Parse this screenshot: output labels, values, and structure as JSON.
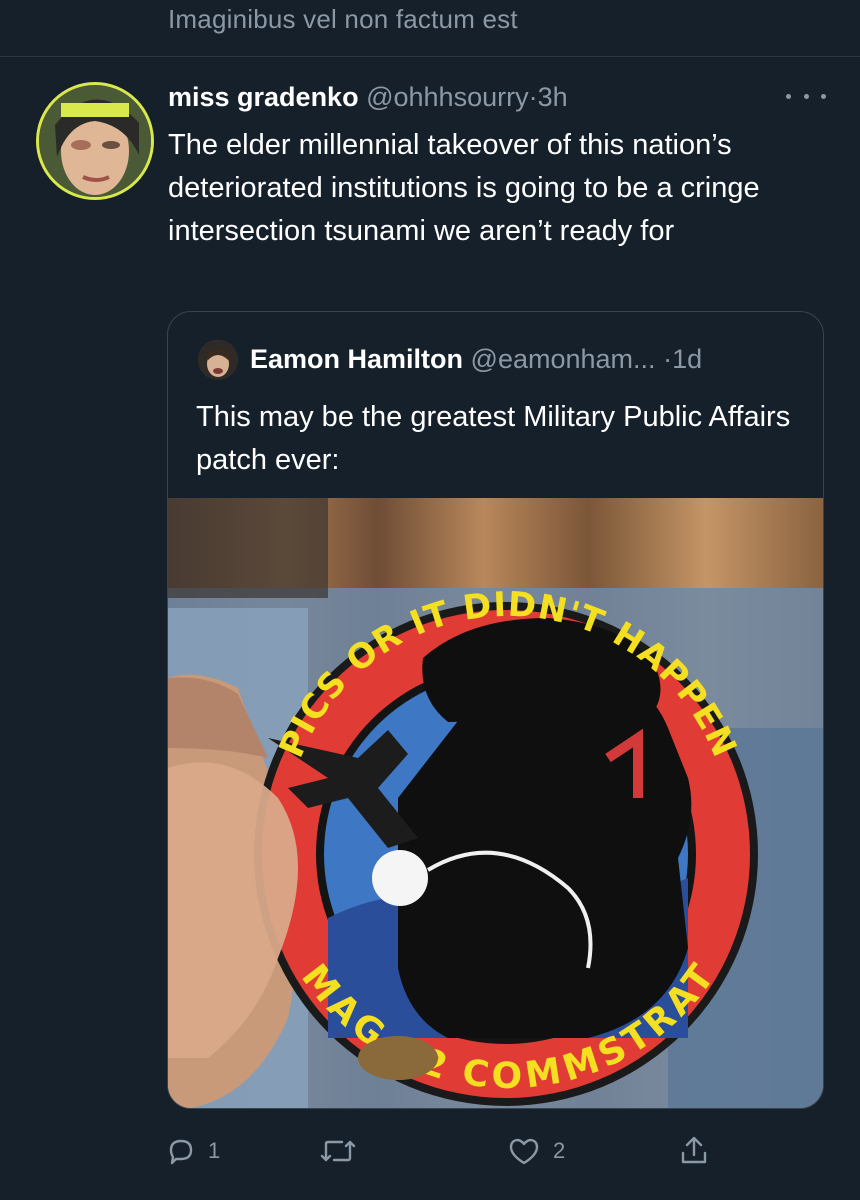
{
  "banner": {
    "text": "Imaginibus vel non factum est"
  },
  "tweet": {
    "author_name": "miss gradenko",
    "author_handle": "@ohhhsourry",
    "separator": "·",
    "time": "3h",
    "text": "The elder millennial takeover of this nation’s deteriorated institutions is going to be a cringe intersection tsunami we aren’t ready for"
  },
  "quote": {
    "author_name": "Eamon Hamilton",
    "author_handle": "@eamonham...",
    "separator": "·",
    "time": "1d",
    "text": "This may be the greatest Military Public Affairs patch ever:",
    "image": {
      "patch_top_text": "PICS OR IT DIDN'T HAPPEN",
      "patch_bottom_text": "MAG-12 COMMSTRAT"
    }
  },
  "actions": {
    "reply_count": "1",
    "retweet_count": "",
    "like_count": "2"
  },
  "colors": {
    "background": "#15202b",
    "secondary_text": "#8b98a5",
    "border": "#38444d"
  },
  "icons": [
    "more-icon",
    "reply-icon",
    "retweet-icon",
    "like-icon",
    "share-icon"
  ]
}
